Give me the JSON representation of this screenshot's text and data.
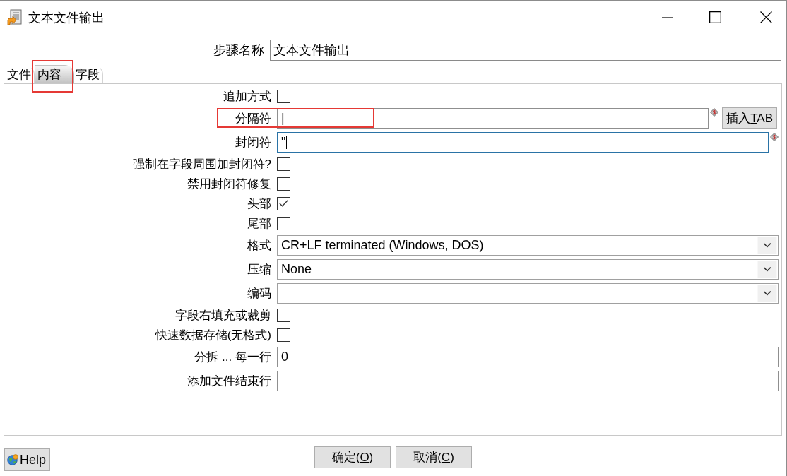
{
  "window": {
    "title": "文本文件输出"
  },
  "step_name": {
    "label": "步骤名称",
    "value": "文本文件输出"
  },
  "tabs": [
    {
      "label": "文件",
      "selected": false,
      "highlighted": false
    },
    {
      "label": "内容",
      "selected": true,
      "highlighted": true
    },
    {
      "label": "字段",
      "selected": false,
      "highlighted": false
    }
  ],
  "fields": [
    {
      "kind": "checkbox",
      "label": "追加方式",
      "checked": false,
      "highlighted": false
    },
    {
      "kind": "text",
      "label": "分隔符",
      "value": "|",
      "focused": false,
      "highlighted": true,
      "variable_icon": true,
      "button": {
        "before": "插入",
        "mnemonic": "T",
        "after": "AB"
      }
    },
    {
      "kind": "text",
      "label": "封闭符",
      "value": "\"",
      "focused": true,
      "highlighted": false,
      "variable_icon": true
    },
    {
      "kind": "checkbox",
      "label": "强制在字段周围加封闭符?",
      "checked": false,
      "highlighted": false
    },
    {
      "kind": "checkbox",
      "label": "禁用封闭符修复",
      "checked": false,
      "highlighted": false
    },
    {
      "kind": "checkbox",
      "label": "头部",
      "checked": true,
      "highlighted": false
    },
    {
      "kind": "checkbox",
      "label": "尾部",
      "checked": false,
      "highlighted": false
    },
    {
      "kind": "dropdown",
      "label": "格式",
      "value": "CR+LF terminated (Windows, DOS)",
      "highlighted": false
    },
    {
      "kind": "dropdown",
      "label": "压缩",
      "value": "None",
      "highlighted": false
    },
    {
      "kind": "dropdown",
      "label": "编码",
      "highlighted": false
    },
    {
      "kind": "checkbox",
      "label": "字段右填充或裁剪",
      "checked": false,
      "highlighted": false
    },
    {
      "kind": "checkbox",
      "label": "快速数据存储(无格式)",
      "checked": false,
      "highlighted": false
    },
    {
      "kind": "text",
      "label": "分拆 ... 每一行",
      "value": "0",
      "focused": false,
      "highlighted": false,
      "variable_icon": false
    },
    {
      "kind": "text",
      "label": "添加文件结束行",
      "focused": false,
      "highlighted": false,
      "variable_icon": false
    }
  ],
  "help_button": {
    "label": "Help"
  },
  "dialog_buttons": [
    {
      "before": "确定(",
      "mnemonic": "O",
      "after": ")"
    },
    {
      "before": "取消(",
      "mnemonic": "C",
      "after": ")"
    }
  ]
}
